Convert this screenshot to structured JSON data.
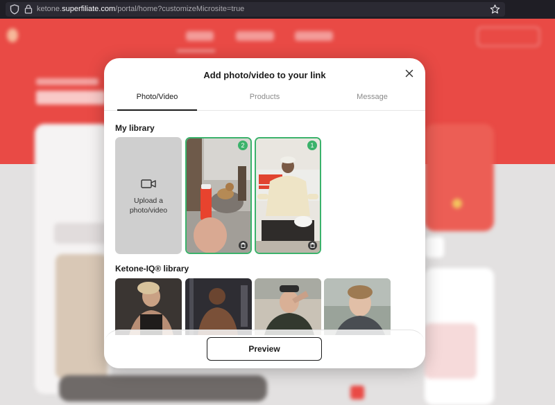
{
  "browser": {
    "url_prefix": "ketone.",
    "url_domain": "superfiliate.com",
    "url_path": "/portal/home?customizeMicrosite=true"
  },
  "modal": {
    "title": "Add photo/video to your link",
    "tabs": [
      {
        "label": "Photo/Video",
        "active": true
      },
      {
        "label": "Products",
        "active": false
      },
      {
        "label": "Message",
        "active": false
      }
    ],
    "my_library": {
      "title": "My library",
      "upload_label_line1": "Upload a",
      "upload_label_line2": "photo/video",
      "items": [
        {
          "badge": "2",
          "selected": true
        },
        {
          "badge": "1",
          "selected": true
        }
      ]
    },
    "brand_library": {
      "title": "Ketone-IQ® library"
    },
    "preview_label": "Preview"
  },
  "colors": {
    "accent_green": "#3bb26b",
    "brand_red": "#e94a45",
    "tile_gray": "#cfcfcf"
  }
}
